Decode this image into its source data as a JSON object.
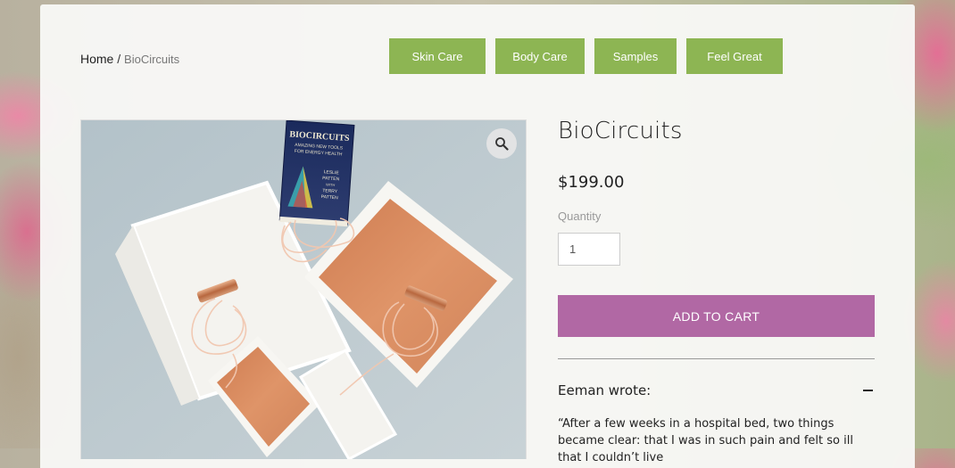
{
  "breadcrumb": {
    "home": "Home",
    "separator": "/",
    "current": "BioCircuits"
  },
  "nav": {
    "items": [
      "Skin Care",
      "Body Care",
      "Samples",
      "Feel Great"
    ]
  },
  "product": {
    "title": "BioCircuits",
    "price": "$199.00",
    "quantity_label": "Quantity",
    "quantity_value": "1",
    "add_to_cart": "ADD TO CART"
  },
  "photo": {
    "book": {
      "title": "BIOCIRCUITS",
      "subtitle_1": "AMAZING NEW TOOLS",
      "subtitle_2": "FOR ENERGY HEALTH",
      "author_1": "LESLIE",
      "author_2": "PATTEN",
      "author_3": "WITH",
      "author_4": "TERRY",
      "author_5": "PATTEN"
    }
  },
  "review": {
    "author": "Eeman wrote:",
    "text": "“After a few weeks in a hospital bed, two things became clear: that I was in such pain and felt so ill that I couldn’t live"
  },
  "colors": {
    "nav_green": "#8db553",
    "add_to_cart_purple": "#b168a4",
    "copper": "#d98a5c"
  },
  "icons": {
    "zoom": "magnifier-icon",
    "collapse": "minus-icon"
  }
}
